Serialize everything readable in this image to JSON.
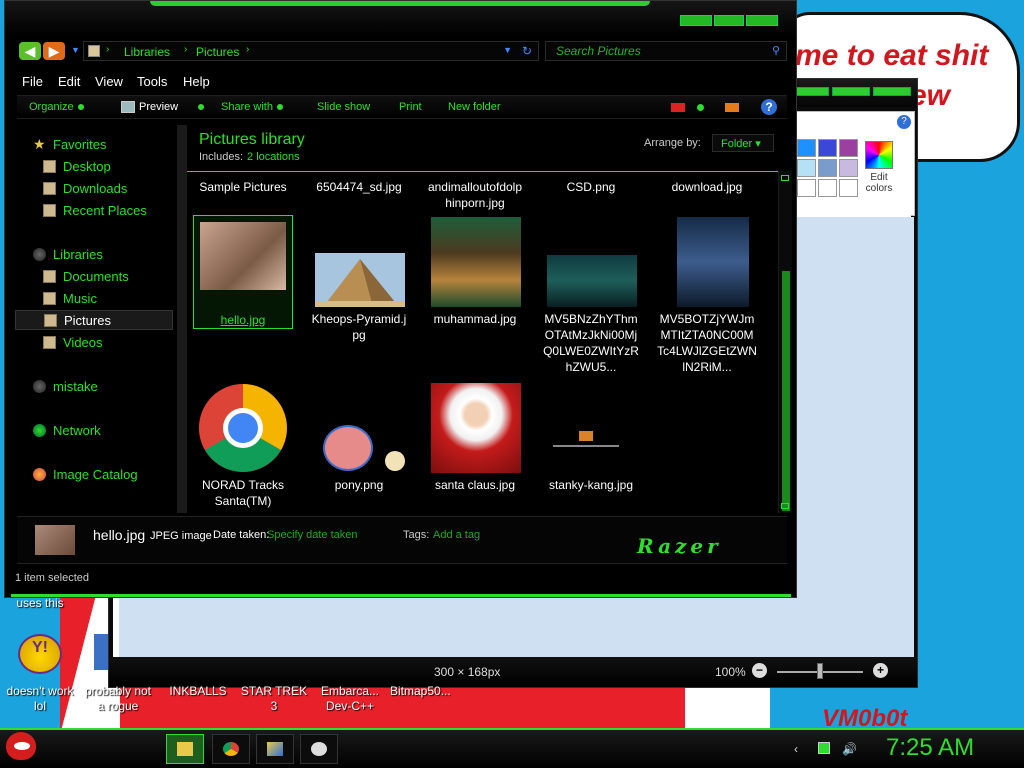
{
  "background": {
    "speech_bubble_text": [
      "me to eat shit",
      "ew"
    ],
    "signature": "VM0b0t"
  },
  "paint": {
    "edit_colors_label": "Edit colors",
    "status": {
      "dimensions": "300 × 168px",
      "zoom": "100%",
      "zoom_out": "−",
      "zoom_in": "+"
    },
    "help": "?"
  },
  "explorer": {
    "address": {
      "crumbs": [
        "Libraries",
        "Pictures"
      ]
    },
    "search_placeholder": "Search Pictures",
    "menu": [
      "File",
      "Edit",
      "View",
      "Tools",
      "Help"
    ],
    "toolbar": [
      "Organize",
      "Preview",
      "Share with",
      "Slide show",
      "Print",
      "New folder"
    ],
    "toolbar_help": "?",
    "nav": {
      "favorites": "Favorites",
      "desktop": "Desktop",
      "downloads": "Downloads",
      "recent": "Recent Places",
      "libraries": "Libraries",
      "documents": "Documents",
      "music": "Music",
      "pictures": "Pictures",
      "videos": "Videos",
      "mistake": "mistake",
      "network": "Network",
      "image_catalog": "Image Catalog"
    },
    "library_title": "Pictures library",
    "includes_label": "Includes:",
    "includes_link": "2 locations",
    "arrange_label": "Arrange by:",
    "arrange_value": "Folder",
    "files": [
      {
        "name": "Sample Pictures"
      },
      {
        "name": "6504474_sd.jpg"
      },
      {
        "name": "andimalloutofdolphinporn.jpg"
      },
      {
        "name": "CSD.png"
      },
      {
        "name": "download.jpg"
      },
      {
        "name": "hello.jpg"
      },
      {
        "name": "Kheops-Pyramid.jpg"
      },
      {
        "name": "muhammad.jpg"
      },
      {
        "name": "MV5BNzZhYThmOTAtMzJkNi00MjQ0LWE0ZWItYzRhZWU5..."
      },
      {
        "name": "MV5BOTZjYWJmMTItZTA0NC00MTc4LWJlZGEtZWNlN2RiM..."
      },
      {
        "name": "NORAD Tracks Santa(TM)"
      },
      {
        "name": "pony.png"
      },
      {
        "name": "santa claus.jpg"
      },
      {
        "name": "stanky-kang.jpg"
      }
    ],
    "selected_file": "hello.jpg",
    "details": {
      "filename": "hello.jpg",
      "type": "JPEG image",
      "date_label": "Date taken:",
      "date_value": "Specify date taken",
      "tags_label": "Tags:",
      "tags_value": "Add a tag",
      "brand": "Razer"
    },
    "status": "1 item selected"
  },
  "desktop_icons": [
    {
      "label": "uses this"
    },
    {
      "label": "doesn't work lol"
    },
    {
      "label": "probably not a rogue"
    },
    {
      "label": "INKBALLS"
    },
    {
      "label": "STAR TREK 3"
    },
    {
      "label": "Embarca... Dev-C++"
    },
    {
      "label": "Bitmap50..."
    }
  ],
  "taskbar": {
    "clock": "7:25 AM"
  },
  "colors": {
    "accent": "#2ede2e",
    "window_bg": "#000000",
    "desktop_bg": "#1ba3dd"
  }
}
